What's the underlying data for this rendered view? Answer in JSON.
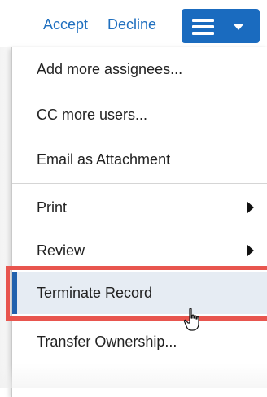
{
  "header": {
    "accept_label": "Accept",
    "decline_label": "Decline",
    "menu_button_icon": "hamburger-icon",
    "menu_button_caret": "caret-down-icon"
  },
  "menu": {
    "items": [
      {
        "label": "Add more assignees...",
        "has_submenu": false
      },
      {
        "label": "CC more users...",
        "has_submenu": false
      },
      {
        "label": "Email as Attachment",
        "has_submenu": false
      },
      {
        "label": "Print",
        "has_submenu": true
      },
      {
        "label": "Review",
        "has_submenu": true
      },
      {
        "label": "Terminate Record",
        "has_submenu": false,
        "hovered": true
      },
      {
        "label": "Transfer Ownership...",
        "has_submenu": false
      }
    ]
  },
  "colors": {
    "link": "#1f6fbf",
    "menu_button_bg": "#1a6bbf",
    "hover_bg": "#e6ecf3",
    "hover_accent": "#2161ad",
    "highlight_outline": "#e8554e"
  },
  "cursor": "hand-pointer-icon"
}
